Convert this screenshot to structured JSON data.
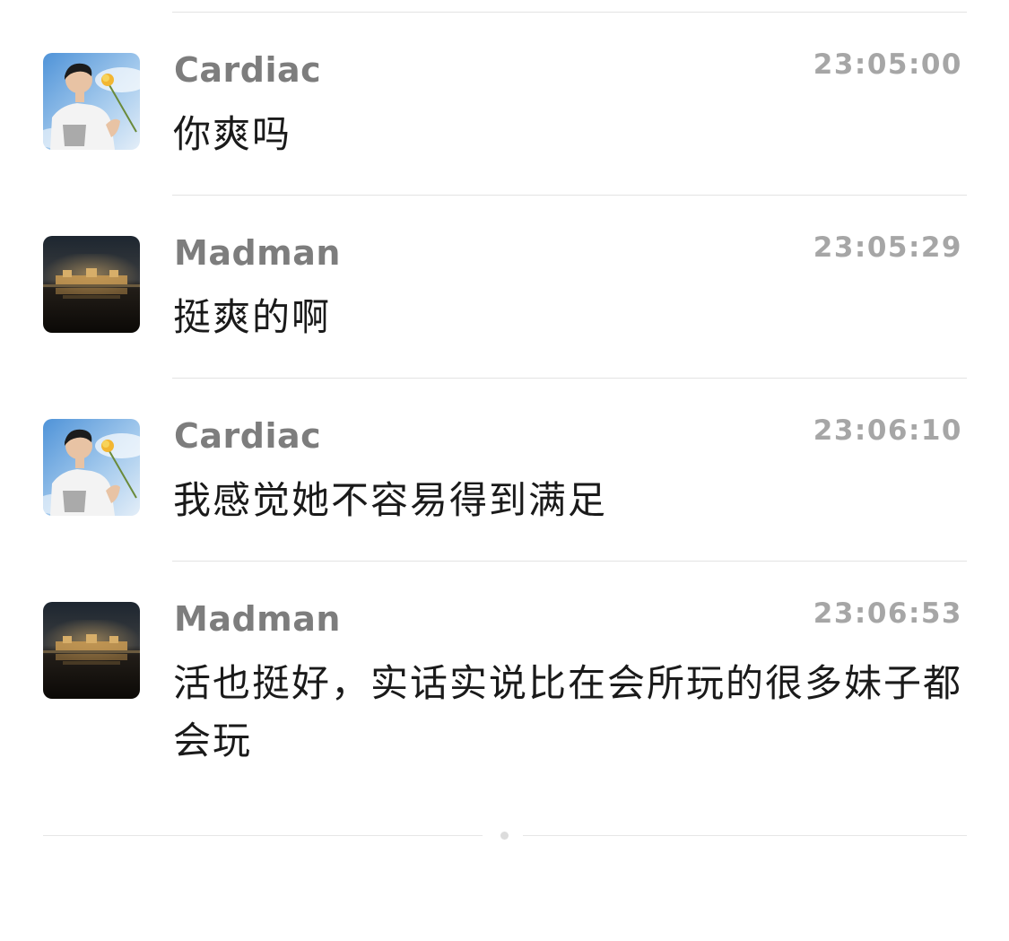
{
  "messages": [
    {
      "sender": "Cardiac",
      "avatar_icon": "avatar-portrait-with-flower",
      "time": "23:05:00",
      "text": "你爽吗"
    },
    {
      "sender": "Madman",
      "avatar_icon": "avatar-night-city-skyline",
      "time": "23:05:29",
      "text": "挺爽的啊"
    },
    {
      "sender": "Cardiac",
      "avatar_icon": "avatar-portrait-with-flower",
      "time": "23:06:10",
      "text": "我感觉她不容易得到满足"
    },
    {
      "sender": "Madman",
      "avatar_icon": "avatar-night-city-skyline",
      "time": "23:06:53",
      "text": "活也挺好，实话实说比在会所玩的很多妹子都会玩"
    }
  ],
  "colors": {
    "sender_name": "#7d7d7d",
    "timestamp": "#a6a6a6",
    "message_text": "#1a1a1a",
    "divider": "#e3e3e3"
  }
}
